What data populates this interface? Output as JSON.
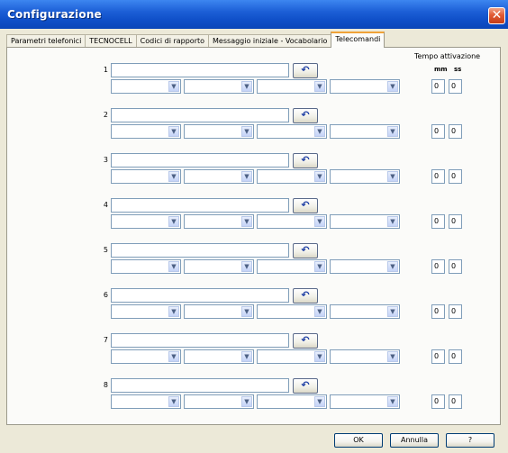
{
  "window": {
    "title": "Configurazione",
    "close_glyph": "✕"
  },
  "tabs": [
    {
      "label": "Parametri telefonici",
      "active": false
    },
    {
      "label": "TECNOCELL",
      "active": false
    },
    {
      "label": "Codici di rapporto",
      "active": false
    },
    {
      "label": "Messaggio iniziale - Vocabolario",
      "active": false
    },
    {
      "label": "Telecomandi",
      "active": true
    }
  ],
  "header": {
    "tempo": "Tempo attivazione",
    "mm": "mm",
    "ss": "ss"
  },
  "icons": {
    "reset": "undo-arrow-icon",
    "dropdown": "chevron-down-icon"
  },
  "reset_glyph": "↶",
  "dropdown_glyph": "▼",
  "rows": [
    {
      "num": "1",
      "command": "",
      "mm": "0",
      "ss": "0",
      "combos": [
        "",
        "",
        "",
        ""
      ]
    },
    {
      "num": "2",
      "command": "",
      "mm": "0",
      "ss": "0",
      "combos": [
        "",
        "",
        "",
        ""
      ]
    },
    {
      "num": "3",
      "command": "",
      "mm": "0",
      "ss": "0",
      "combos": [
        "",
        "",
        "",
        ""
      ]
    },
    {
      "num": "4",
      "command": "",
      "mm": "0",
      "ss": "0",
      "combos": [
        "",
        "",
        "",
        ""
      ]
    },
    {
      "num": "5",
      "command": "",
      "mm": "0",
      "ss": "0",
      "combos": [
        "",
        "",
        "",
        ""
      ]
    },
    {
      "num": "6",
      "command": "",
      "mm": "0",
      "ss": "0",
      "combos": [
        "",
        "",
        "",
        ""
      ]
    },
    {
      "num": "7",
      "command": "",
      "mm": "0",
      "ss": "0",
      "combos": [
        "",
        "",
        "",
        ""
      ]
    },
    {
      "num": "8",
      "command": "",
      "mm": "0",
      "ss": "0",
      "combos": [
        "",
        "",
        "",
        ""
      ]
    }
  ],
  "buttons": {
    "ok": "OK",
    "cancel": "Annulla",
    "help": "?"
  },
  "colors": {
    "title_bar": "#1c5fd6",
    "close_button": "#e25b35",
    "active_tab_highlight": "#f0a238"
  }
}
